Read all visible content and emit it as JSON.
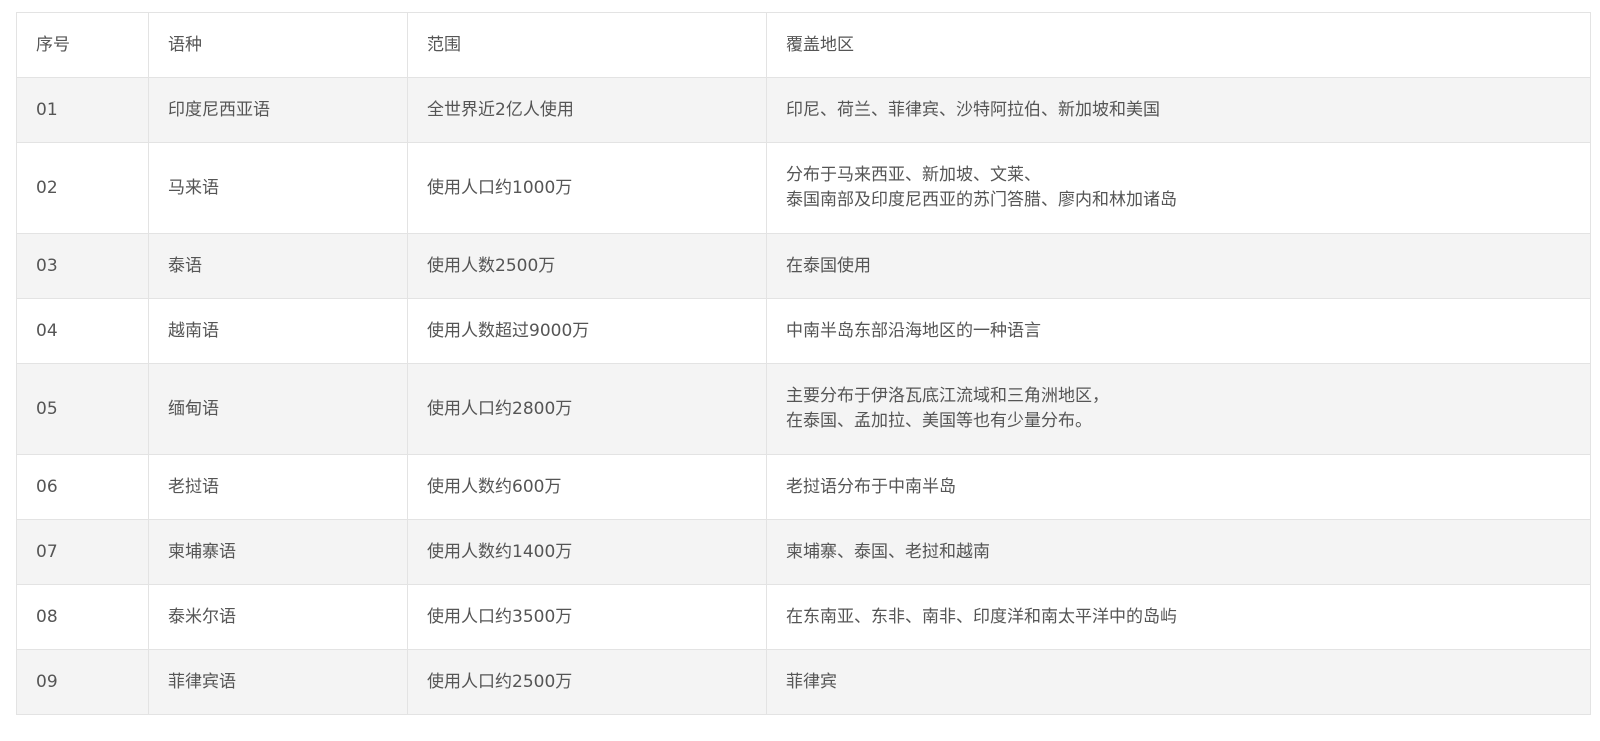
{
  "table": {
    "headers": [
      "序号",
      "语种",
      "范围",
      "覆盖地区"
    ],
    "rows": [
      {
        "no": "01",
        "language": "印度尼西亚语",
        "scope": "全世界近2亿人使用",
        "region_lines": [
          "印尼、荷兰、菲律宾、沙特阿拉伯、新加坡和美国"
        ]
      },
      {
        "no": "02",
        "language": "马来语",
        "scope": "使用人口约1000万",
        "region_lines": [
          "分布于马来西亚、新加坡、文莱、",
          "泰国南部及印度尼西亚的苏门答腊、廖内和林加诸岛"
        ]
      },
      {
        "no": "03",
        "language": "泰语",
        "scope": "使用人数2500万",
        "region_lines": [
          "在泰国使用"
        ]
      },
      {
        "no": "04",
        "language": "越南语",
        "scope": "使用人数超过9000万",
        "region_lines": [
          "中南半岛东部沿海地区的一种语言"
        ]
      },
      {
        "no": "05",
        "language": "缅甸语",
        "scope": "使用人口约2800万",
        "region_lines": [
          "主要分布于伊洛瓦底江流域和三角洲地区，",
          "在泰国、孟加拉、美国等也有少量分布。"
        ]
      },
      {
        "no": "06",
        "language": "老挝语",
        "scope": "使用人数约600万",
        "region_lines": [
          "老挝语分布于中南半岛"
        ]
      },
      {
        "no": "07",
        "language": "柬埔寨语",
        "scope": "使用人数约1400万",
        "region_lines": [
          "柬埔寨、泰国、老挝和越南"
        ]
      },
      {
        "no": "08",
        "language": "泰米尔语",
        "scope": "使用人口约3500万",
        "region_lines": [
          "在东南亚、东非、南非、印度洋和南太平洋中的岛屿"
        ]
      },
      {
        "no": "09",
        "language": "菲律宾语",
        "scope": "使用人口约2500万",
        "region_lines": [
          "菲律宾"
        ]
      }
    ]
  }
}
